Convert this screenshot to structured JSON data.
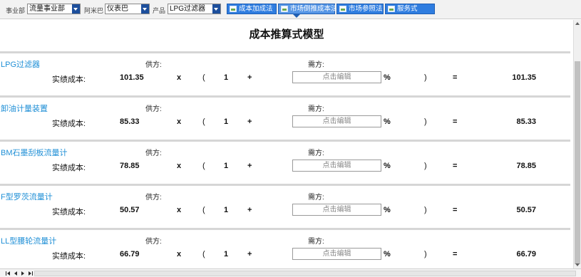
{
  "toolbar": {
    "division_label": "事业部",
    "division_value": "流量事业部",
    "amoeba_label": "阿米巴",
    "amoeba_value": "仪表巴",
    "product_label": "产品",
    "product_value": "LPG过滤器",
    "buttons": [
      {
        "label": "成本加成法",
        "icon": "image-icon"
      },
      {
        "label": "市场倒推成本法",
        "icon": "image-icon",
        "active": true
      },
      {
        "label": "市场参照法",
        "icon": "image-icon"
      },
      {
        "label": "服务式",
        "icon": "image-icon"
      }
    ]
  },
  "page": {
    "title": "成本推算式模型",
    "supply_label": "供方:",
    "demand_label": "需方:",
    "cost_label": "实绩成本:",
    "multiply": "x",
    "open_paren": "(",
    "one": "1",
    "plus": "+",
    "edit_placeholder": "点击编辑",
    "percent": "%",
    "close_paren": ")",
    "equals": "="
  },
  "items": [
    {
      "name": "LPG过滤器",
      "actual_cost": "101.35",
      "result": "101.35"
    },
    {
      "name": "卸油计量装置",
      "actual_cost": "85.33",
      "result": "85.33"
    },
    {
      "name": "BM石墨刮板流量计",
      "actual_cost": "78.85",
      "result": "78.85"
    },
    {
      "name": "F型罗茨流量计",
      "actual_cost": "50.57",
      "result": "50.57"
    },
    {
      "name": "LL型腰轮流量计",
      "actual_cost": "66.79",
      "result": "66.79"
    }
  ],
  "colors": {
    "accent_blue": "#2f7de0",
    "item_name_blue": "#1f8fd6",
    "dropdown_arrow": "#1d4f9c"
  }
}
